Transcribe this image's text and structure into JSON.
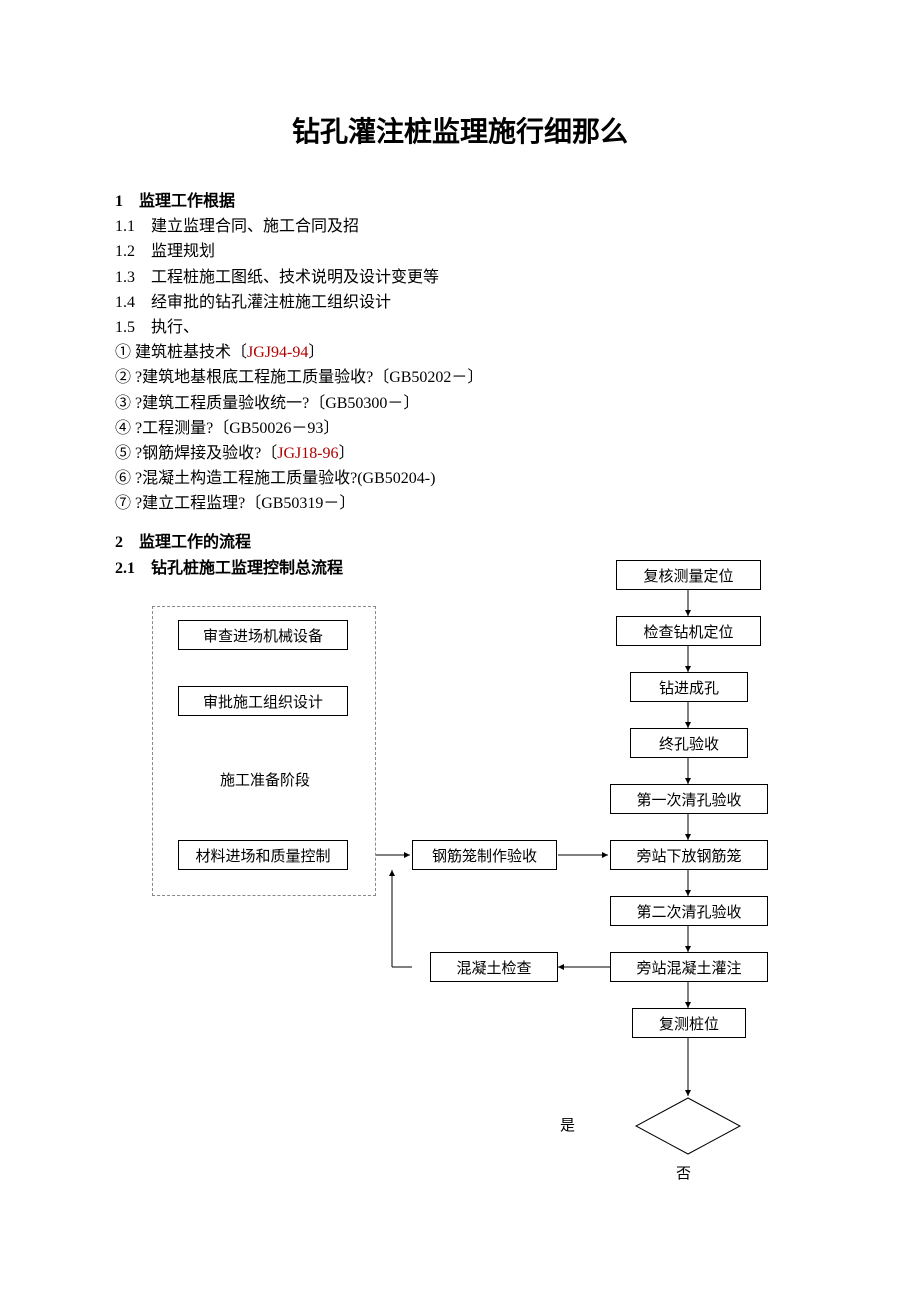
{
  "title": "钻孔灌注桩监理施行细那么",
  "s1": {
    "head": "1　监理工作根据",
    "l1": "1.1　建立监理合同、施工合同及招",
    "l2": "1.2　监理规划",
    "l3": "1.3　工程桩施工图纸、技术说明及设计变更等",
    "l4": "1.4　经审批的钻孔灌注桩施工组织设计",
    "l5": "1.5　执行、",
    "i1a": "①  建筑桩基技术〔",
    "i1b": "JGJ94-94",
    "i1c": "〕",
    "i2": "②  ?建筑地基根底工程施工质量验收?〔GB50202－〕",
    "i3": "③  ?建筑工程质量验收统一?〔GB50300－〕",
    "i4": "④  ?工程测量?〔GB50026－93〕",
    "i5a": "⑤  ?钢筋焊接及验收?〔",
    "i5b": "JGJ18-96",
    "i5c": "〕",
    "i6": "⑥  ?混凝土构造工程施工质量验收?(GB50204-)",
    "i7": "⑦  ?建立工程监理?〔GB50319－〕"
  },
  "s2": {
    "head": "2　监理工作的流程",
    "sub": "2.1　钻孔桩施工监理控制总流程"
  },
  "boxes": {
    "b1": "审查进场机械设备",
    "b2": "审批施工组织设计",
    "b3": "材料进场和质量控制",
    "c1": "钢筋笼制作验收",
    "c2": "混凝土检查",
    "r1": "复核测量定位",
    "r2": "检查钻机定位",
    "r3": "钻进成孔",
    "r4": "终孔验收",
    "r5": "第一次清孔验收",
    "r6": "旁站下放钢筋笼",
    "r7": "第二次清孔验收",
    "r8": "旁站混凝土灌注",
    "r9": "复测桩位",
    "prep": "施工准备阶段",
    "yes": "是",
    "no": "否"
  }
}
